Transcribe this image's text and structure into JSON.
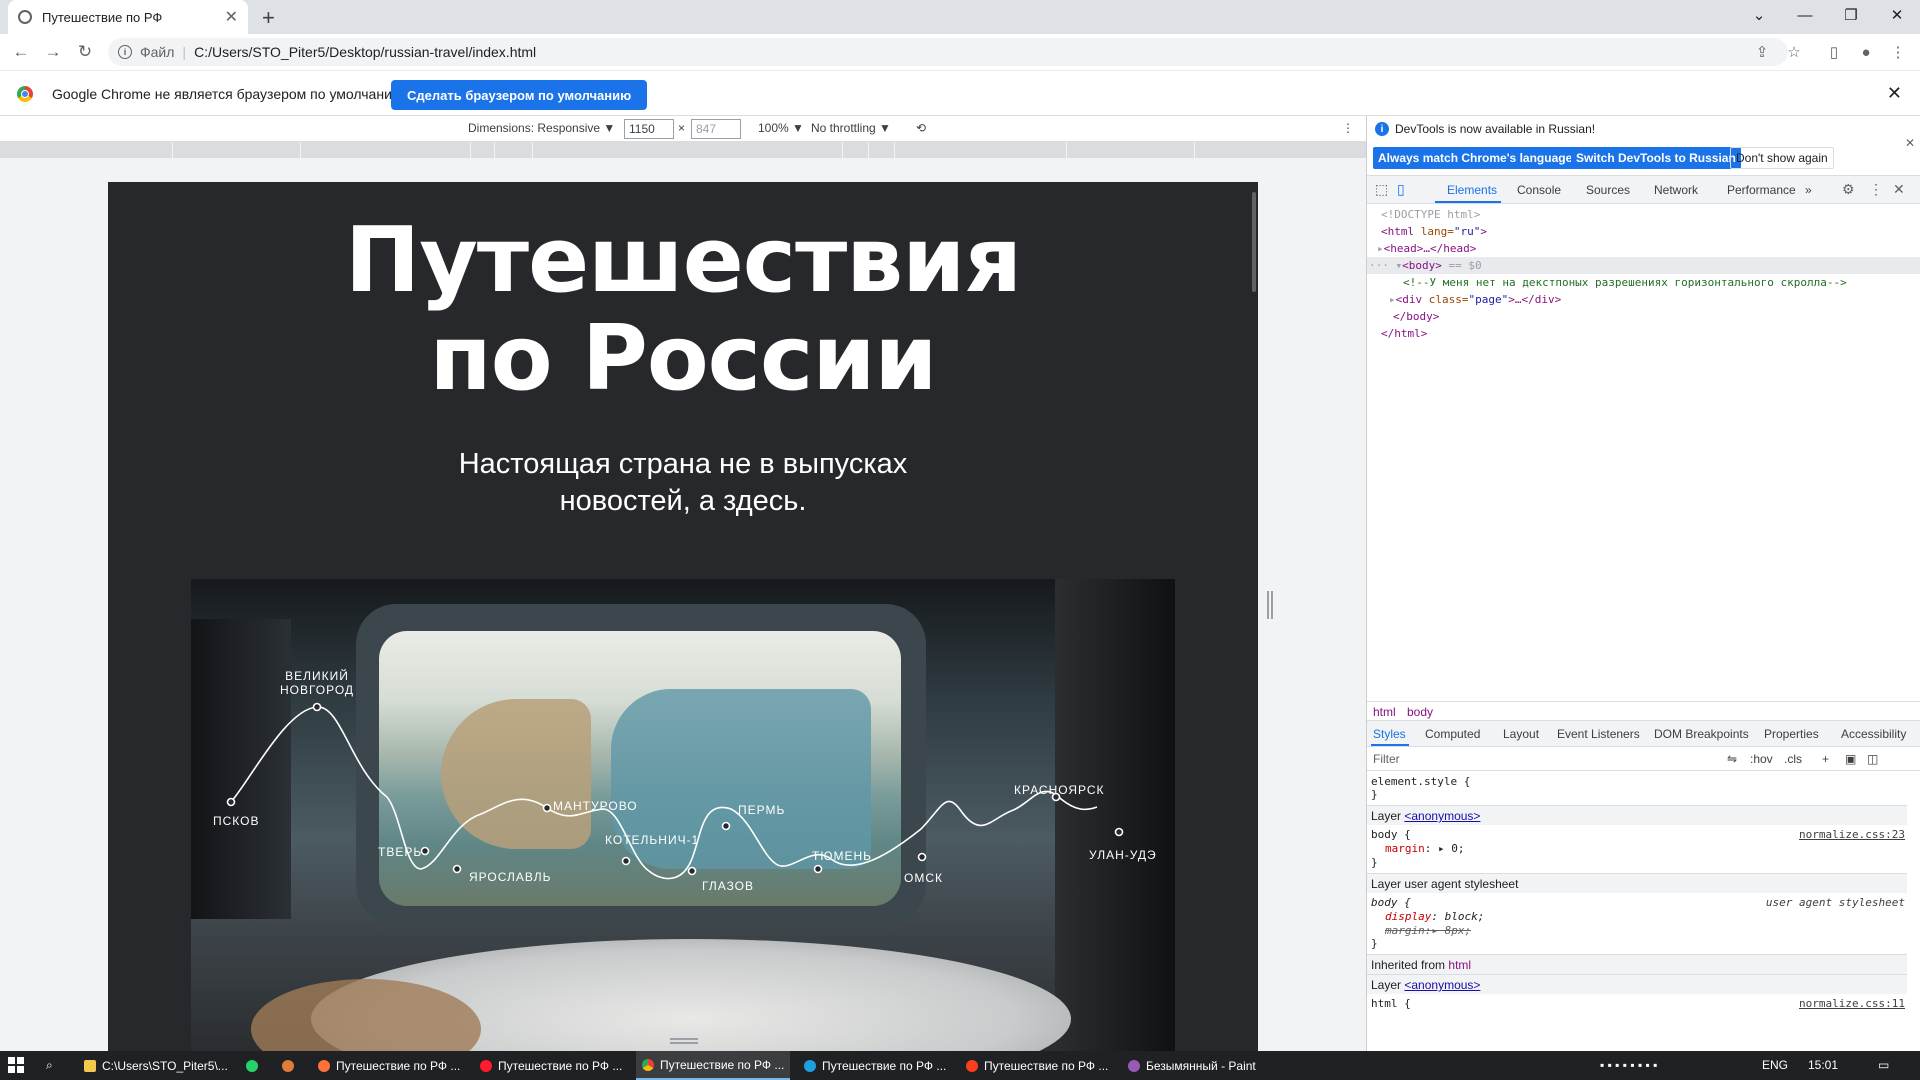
{
  "browser": {
    "tab_title": "Путешествие по РФ",
    "address_scheme": "Файл",
    "address_url": "C:/Users/STO_Piter5/Desktop/russian-travel/index.html"
  },
  "infobar": {
    "message": "Google Chrome не является браузером по умолчанию.",
    "button": "Сделать браузером по умолчанию"
  },
  "device_toolbar": {
    "dimensions_label": "Dimensions: Responsive ▼",
    "width": "1150",
    "times": "×",
    "height": "847",
    "zoom": "100% ▼",
    "throttling": "No throttling ▼"
  },
  "page": {
    "title_line1": "Путешествия",
    "title_line2": "по России",
    "subtitle_line1": "Настоящая страна не в выпусках",
    "subtitle_line2": "новостей, а здесь.",
    "cities": [
      "ВЕЛИКИЙ",
      "НОВГОРОД",
      "ПСКОВ",
      "ТВЕРЬ",
      "ЯРОСЛАВЛЬ",
      "МАНТУРОВО",
      "КОТЕЛЬНИЧ-1",
      "ПЕРМЬ",
      "ГЛАЗОВ",
      "ТЮМЕНЬ",
      "ОМСК",
      "КРАСНОЯРСК",
      "УЛАН-УДЭ"
    ]
  },
  "devtools": {
    "notice": "DevTools is now available in Russian!",
    "btn_match": "Always match Chrome's language",
    "btn_switch": "Switch DevTools to Russian",
    "btn_dont": "Don't show again",
    "tabs": [
      "Elements",
      "Console",
      "Sources",
      "Network",
      "Performance"
    ],
    "more_tabs": "»",
    "dom": {
      "doctype": "<!DOCTYPE html>",
      "html_open_tag": "<html",
      "html_attr": " lang=",
      "html_attr_val": "\"ru\"",
      "html_close_bracket": ">",
      "head": "<head>…</head>",
      "body_tag": "<body>",
      "body_eq": " == $0",
      "comment": "<!--У меня нет на декстпоных разрешениях горизонтального скролла-->",
      "div_open": "<div",
      "div_attr": " class=",
      "div_attr_val": "\"page\"",
      "div_rest": ">…</div>",
      "body_close": "</body>",
      "html_close": "</html>"
    },
    "crumbs": [
      "html",
      "body"
    ],
    "subtabs": [
      "Styles",
      "Computed",
      "Layout",
      "Event Listeners",
      "DOM Breakpoints",
      "Properties",
      "Accessibility"
    ],
    "filter_placeholder": "Filter",
    "filter_hov": ":hov",
    "filter_cls": ".cls",
    "styles": {
      "element_style": "element.style {",
      "close_brace": "}",
      "layer_label": "Layer",
      "layer_anon": "<anonymous>",
      "body_rule": "body {",
      "margin_prop": "margin",
      "margin_val": ": ▸ 0;",
      "normalize_src_1": "normalize.css:23",
      "layer_ua": "Layer user agent stylesheet",
      "ua_body": "body {",
      "ua_src": "user agent stylesheet",
      "display_prop": "display",
      "display_val": ": block;",
      "ua_margin": "margin:▸ 8px;",
      "inherited": "Inherited from",
      "inherited_el": "html",
      "html_rule": "html {",
      "normalize_src_2": "normalize.css:11"
    }
  },
  "taskbar": {
    "items": [
      "C:\\Users\\STO_Piter5\\...",
      "Путешествие по РФ ...",
      "Путешествие по РФ ...",
      "Путешествие по РФ ...",
      "Путешествие по РФ ...",
      "Путешествие по РФ ...",
      "Безымянный - Paint"
    ],
    "lang": "ENG",
    "time": "15:01"
  }
}
